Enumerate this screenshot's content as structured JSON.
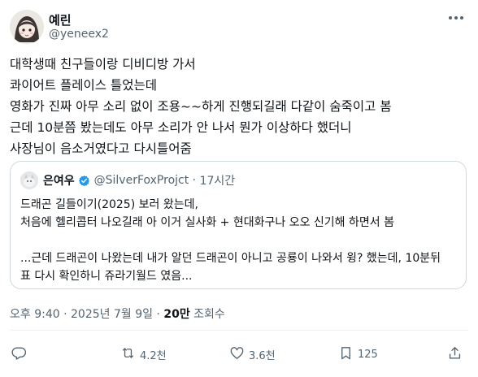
{
  "author": {
    "display_name": "예린",
    "handle": "@yeneex2"
  },
  "tweet_lines": [
    "대학생때 친구들이랑 디비디방 가서",
    "콰이어트 플레이스 틀었는데",
    "영화가 진짜 아무 소리 없이 조용~~하게 진행되길래 다같이 숨죽이고 봄",
    "근데 10분쯤 봤는데도 아무 소리가 안 나서 뭔가 이상하다 했더니",
    "사장님이 음소거였다고 다시틀어줌"
  ],
  "quote": {
    "display_name": "은여우",
    "handle": "@SilverFoxProjct",
    "time": "17시간",
    "lines": [
      "드래곤 길들이기(2025) 보러 왔는데,",
      "처음에 헬리콥터 나오길래 아 이거 실사화 + 현대화구나 오오 신기해 하면서 봄",
      "",
      "...근데 드래곤이 나왔는데 내가 알던 드래곤이 아니고 공룡이 나와서 윙? 했는데, 10분뒤",
      "표 다시 확인하니 쥬라기월드 였음..."
    ]
  },
  "timestamp": {
    "time": "오후 9:40 · 2025년 7월 9일 · ",
    "views_count": "20만",
    "views_label": " 조회수"
  },
  "actions": {
    "reply": "",
    "retweet": "4.2천",
    "like": "3.6천",
    "bookmark": "125"
  },
  "colors": {
    "text": "#0f1419",
    "secondary": "#536471",
    "border": "#cfd9de",
    "verified": "#1d9bf0"
  },
  "icons": [
    "more-icon",
    "verified-badge-icon",
    "reply-icon",
    "retweet-icon",
    "like-icon",
    "bookmark-icon",
    "share-icon"
  ]
}
